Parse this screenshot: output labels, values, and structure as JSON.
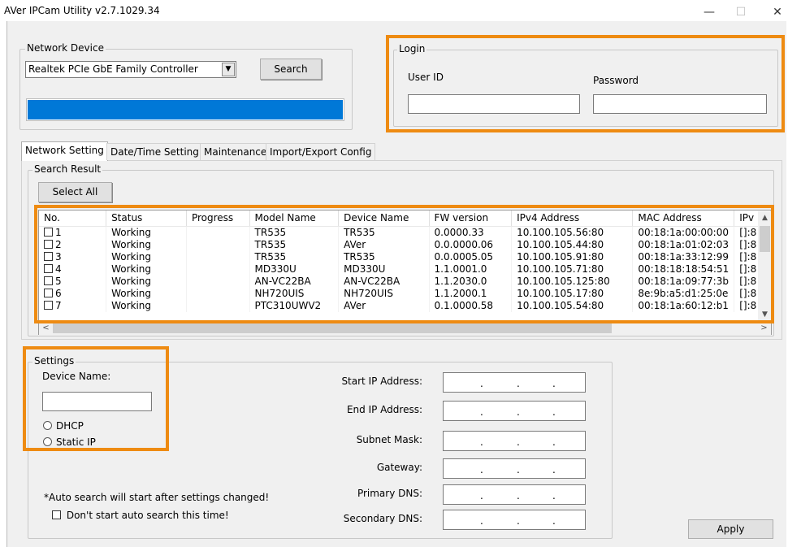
{
  "window": {
    "title": "AVer IPCam Utility v2.7.1029.34",
    "min_glyph": "—",
    "max_glyph": "☐",
    "close_glyph": "✕"
  },
  "network_device": {
    "group_title": "Network Device",
    "adapter_value": "Realtek PCIe GbE Family Controller",
    "dropdown_glyph": "▼",
    "search_label": "Search",
    "progress": 1.0,
    "progress_color": "#0078d7"
  },
  "login": {
    "group_title": "Login",
    "user_id_label": "User ID",
    "user_id_value": "",
    "password_label": "Password",
    "password_value": ""
  },
  "tabs": [
    {
      "label": "Network Setting",
      "active": true
    },
    {
      "label": "Date/Time Setting",
      "active": false
    },
    {
      "label": "Maintenance",
      "active": false
    },
    {
      "label": "Import/Export Config",
      "active": false
    }
  ],
  "search_result": {
    "group_title": "Search Result",
    "select_all_label": "Select All",
    "columns": [
      "No.",
      "Status",
      "Progress",
      "Model Name",
      "Device Name",
      "FW version",
      "IPv4 Address",
      "MAC Address",
      "IPv"
    ],
    "rows": [
      [
        "1",
        "Working",
        "",
        "TR535",
        "TR535",
        "0.0000.33",
        "10.100.105.56:80",
        "00:18:1a:00:00:00",
        "[]:8"
      ],
      [
        "2",
        "Working",
        "",
        "TR535",
        "AVer",
        "0.0.0000.06",
        "10.100.105.44:80",
        "00:18:1a:01:02:03",
        "[]:8"
      ],
      [
        "3",
        "Working",
        "",
        "TR535",
        "TR535",
        "0.0.0005.05",
        "10.100.105.91:80",
        "00:18:1a:33:12:99",
        "[]:8"
      ],
      [
        "4",
        "Working",
        "",
        "MD330U",
        "MD330U",
        "1.1.0001.0",
        "10.100.105.71:80",
        "00:18:18:18:54:51",
        "[]:8"
      ],
      [
        "5",
        "Working",
        "",
        "AN-VC22BA",
        "AN-VC22BA",
        "1.1.2030.0",
        "10.100.105.125:80",
        "00:18:1a:09:77:3b",
        "[]:8"
      ],
      [
        "6",
        "Working",
        "",
        "NH720UIS",
        "NH720UIS",
        "1.1.2000.1",
        "10.100.105.17:80",
        "8e:9b:a5:d1:25:0e",
        "[]:8"
      ],
      [
        "7",
        "Working",
        "",
        "PTC310UWV2",
        "AVer",
        "0.1.0000.58",
        "10.100.105.54:80",
        "00:18:1a:60:12:b1",
        "[]:8"
      ]
    ],
    "scroll_up": "▲",
    "scroll_down": "▼",
    "scroll_left": "<",
    "scroll_right": ">"
  },
  "settings": {
    "group_title": "Settings",
    "device_name_label": "Device Name:",
    "device_name_value": "",
    "dhcp_label": "DHCP",
    "static_label": "Static IP",
    "ip_fields": [
      {
        "label": "Start IP Address:"
      },
      {
        "label": "End IP Address:"
      },
      {
        "label": "Subnet Mask:"
      },
      {
        "label": "Gateway:"
      },
      {
        "label": "Primary DNS:"
      },
      {
        "label": "Secondary DNS:"
      }
    ],
    "ip_dot": ".",
    "auto_note": "*Auto search will start after settings changed!",
    "no_auto_search_label": "Don't start auto search this time!",
    "apply_label": "Apply"
  },
  "highlight_color": "#ee8b12"
}
